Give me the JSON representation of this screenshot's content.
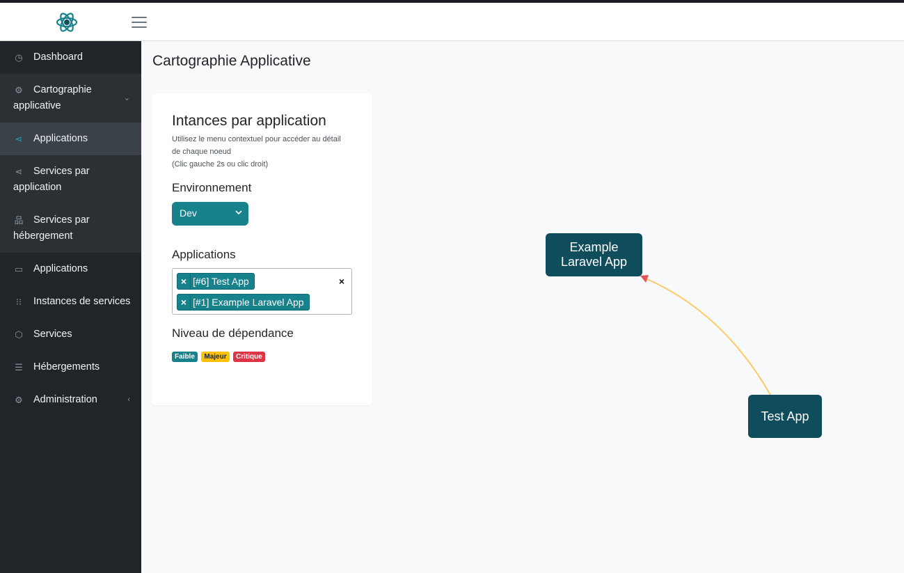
{
  "header": {
    "logo_icon": "atom-icon",
    "menu_icon": "hamburger-icon"
  },
  "sidebar": {
    "items": [
      {
        "label": "Dashboard",
        "icon": "gauge-icon"
      },
      {
        "label": "Cartographie",
        "label2": "applicative",
        "icon": "gear-icon"
      },
      {
        "label": "Applications",
        "icon": "share-icon"
      },
      {
        "label": "Services par",
        "label2": "application",
        "icon": "share-icon"
      },
      {
        "label": "Services par",
        "label2": "hébergement",
        "icon": "sitemap-icon"
      },
      {
        "label": "Applications",
        "icon": "window-icon"
      },
      {
        "label": "Instances de services",
        "icon": "grid-icon"
      },
      {
        "label": "Services",
        "icon": "box-icon"
      },
      {
        "label": "Hébergements",
        "icon": "server-icon"
      },
      {
        "label": "Administration",
        "icon": "gear-icon"
      }
    ]
  },
  "page": {
    "title": "Cartographie Applicative"
  },
  "panel": {
    "title": "Intances par application",
    "hint": [
      "Utilisez le menu contextuel pour accéder au détail",
      "de chaque noeud",
      "(Clic gauche 2s ou clic droit)"
    ],
    "env_label": "Environnement",
    "env_value": "Dev",
    "apps_label": "Applications",
    "selected_apps": [
      "[#6] Test App",
      "[#1] Example Laravel App"
    ],
    "chip_remove": "×",
    "clear_all": "×",
    "dep_label": "Niveau de dépendance",
    "levels": [
      {
        "label": "Faible",
        "color": "#17818c"
      },
      {
        "label": "Majeur",
        "color": "#ffc107"
      },
      {
        "label": "Critique",
        "color": "#dc3545"
      }
    ]
  },
  "graph": {
    "nodes": [
      {
        "label": "Example Laravel App"
      },
      {
        "label": "Test App"
      }
    ],
    "edges": [
      {
        "from": "Test App",
        "to": "Example Laravel App",
        "level": "Majeur",
        "color": "#ffc966"
      }
    ],
    "node_color": "#0f4c5c"
  }
}
